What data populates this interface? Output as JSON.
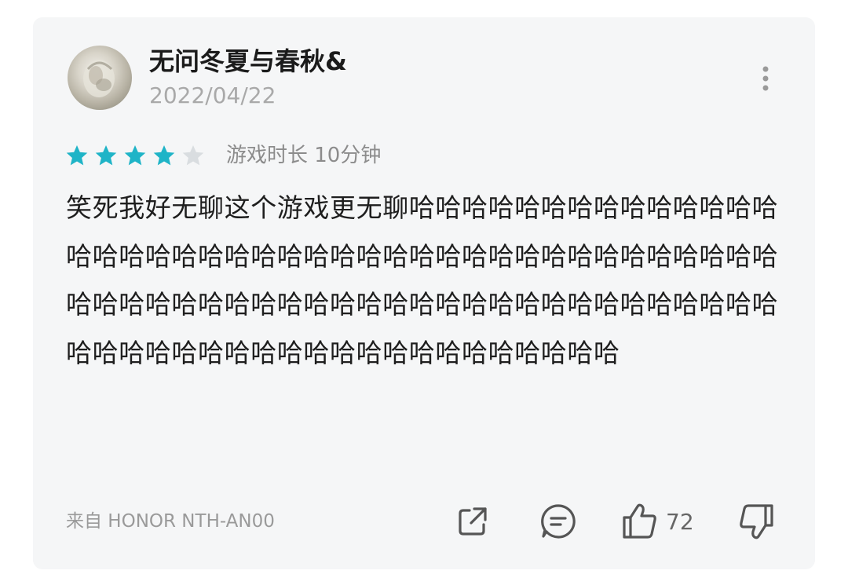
{
  "review": {
    "username": "无问冬夏与春秋&",
    "date": "2022/04/22",
    "rating": 4,
    "rating_max": 5,
    "playtime": "游戏时长 10分钟",
    "text": "笑死我好无聊这个游戏更无聊哈哈哈哈哈哈哈哈哈哈哈哈哈哈哈哈哈哈哈哈哈哈哈哈哈哈哈哈哈哈哈哈哈哈哈哈哈哈哈哈哈哈哈哈哈哈哈哈哈哈哈哈哈哈哈哈哈哈哈哈哈哈哈哈哈哈哈哈哈哈哈哈哈哈哈哈哈哈哈哈哈哈哈哈哈哈哈哈哈",
    "device": "来自 HONOR NTH-AN00",
    "likes": "72"
  },
  "colors": {
    "star_filled": "#1fb4c7",
    "star_empty": "#d9dde0",
    "card_bg": "#f5f6f7",
    "icon_color": "#555555"
  },
  "icons": {
    "more": "more-vertical-icon",
    "share": "share-icon",
    "comment": "comment-icon",
    "like": "thumbs-up-icon",
    "dislike": "thumbs-down-icon"
  }
}
